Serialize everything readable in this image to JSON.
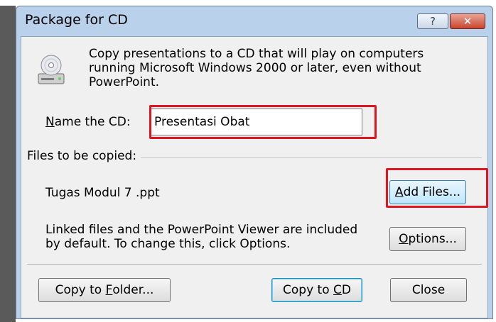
{
  "dialog": {
    "title": "Package for CD",
    "help_glyph": "?",
    "close_glyph": "✕",
    "intro_text": "Copy presentations to a CD that will play on computers running Microsoft Windows 2000 or later, even without PowerPoint.",
    "name_label_prefix": "N",
    "name_label_rest": "ame the CD:",
    "name_value": "Presentasi Obat",
    "files_label": "Files to be copied:",
    "file_name": "Tugas Modul 7 .ppt",
    "add_files_accel": "A",
    "add_files_rest": "dd Files...",
    "linked_text": "Linked files and the PowerPoint Viewer are included by default. To change this, click Options.",
    "options_accel": "O",
    "options_rest": "ptions...",
    "copy_folder_prefix": "Copy to ",
    "copy_folder_accel": "F",
    "copy_folder_rest": "older...",
    "copy_cd_prefix": "Copy to ",
    "copy_cd_accel": "C",
    "copy_cd_rest": "D",
    "close_label": "Close"
  },
  "icons": {
    "cd": "cd-drive-icon",
    "help": "help-icon",
    "close": "close-icon"
  },
  "colors": {
    "highlight": "#e0151f",
    "titlebar": "#b9d1ea",
    "client": "#f0f0f0",
    "close_button": "#c9452e"
  }
}
